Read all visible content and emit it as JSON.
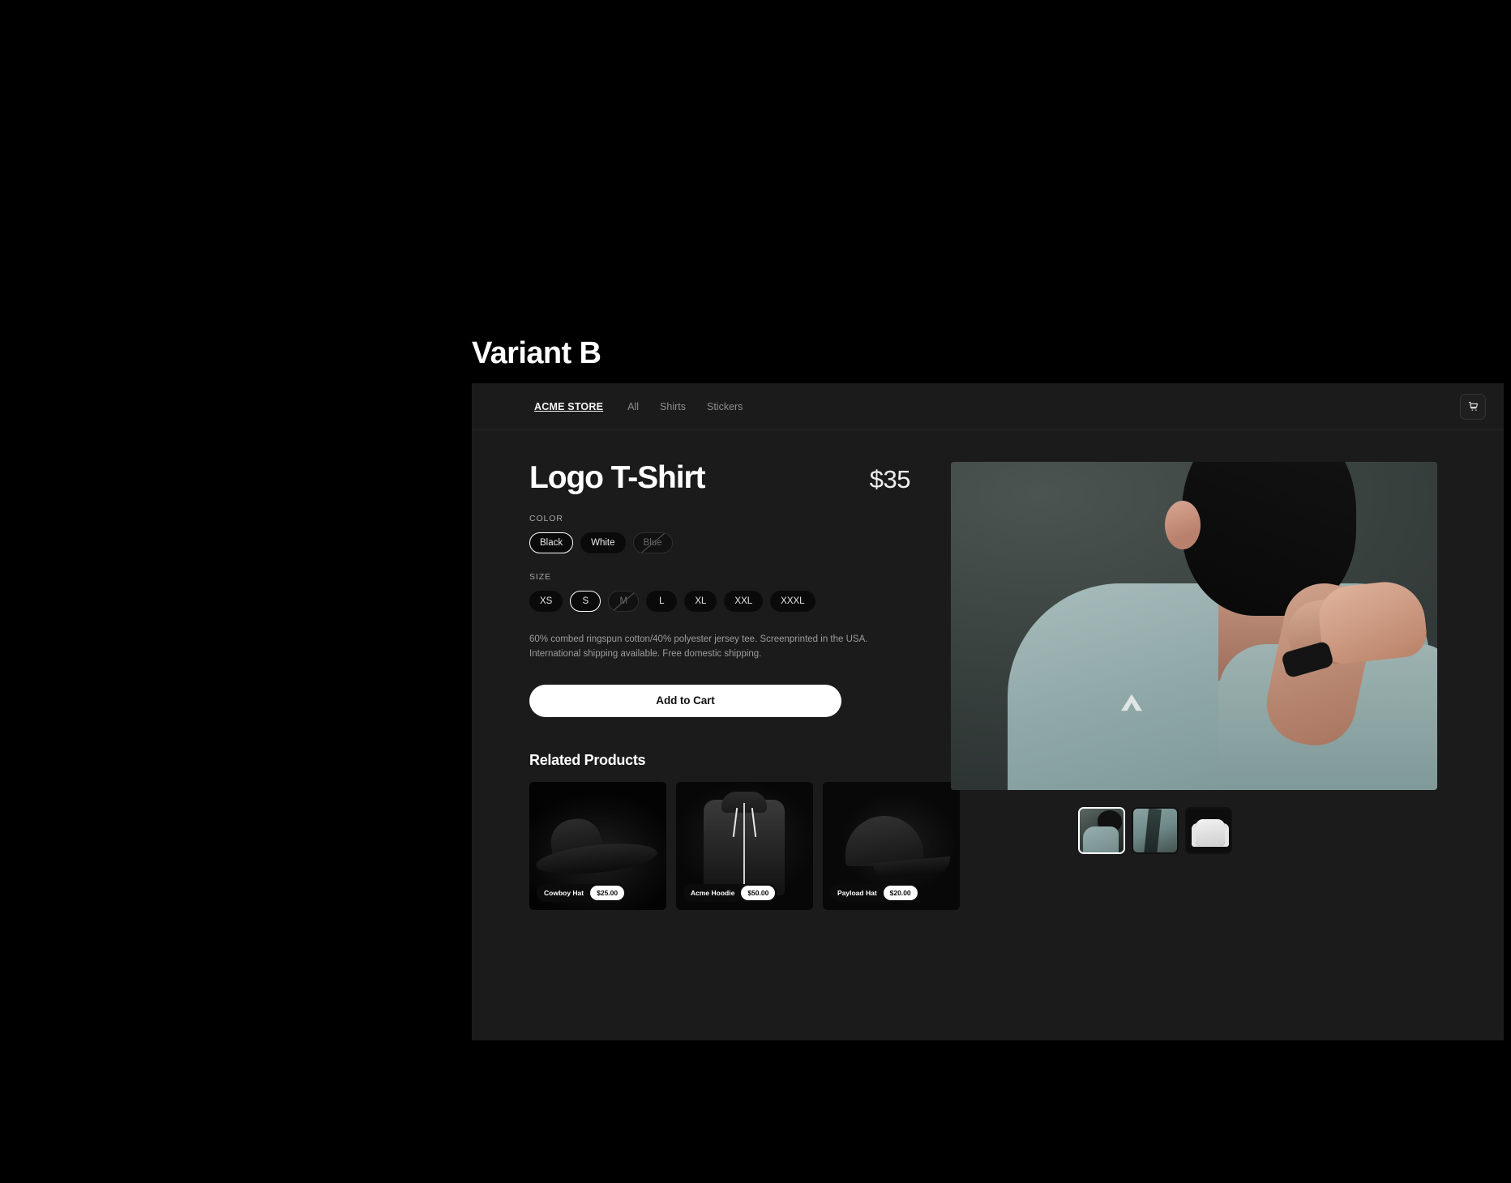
{
  "variant": {
    "label": "Variant B"
  },
  "store_header": {
    "brand": "ACME STORE",
    "nav": [
      {
        "label": "All"
      },
      {
        "label": "Shirts"
      },
      {
        "label": "Stickers"
      }
    ],
    "cart_icon": "shopping-cart-icon"
  },
  "product": {
    "title": "Logo T-Shirt",
    "price": "$35",
    "color_label": "COLOR",
    "colors": [
      {
        "label": "Black",
        "state": "selected"
      },
      {
        "label": "White",
        "state": "available"
      },
      {
        "label": "Blue",
        "state": "disabled"
      }
    ],
    "size_label": "SIZE",
    "sizes": [
      {
        "label": "XS",
        "state": "available"
      },
      {
        "label": "S",
        "state": "selected"
      },
      {
        "label": "M",
        "state": "disabled"
      },
      {
        "label": "L",
        "state": "available"
      },
      {
        "label": "XL",
        "state": "available"
      },
      {
        "label": "XXL",
        "state": "available"
      },
      {
        "label": "XXXL",
        "state": "available"
      }
    ],
    "description": "60% combed ringspun cotton/40% polyester jersey tee. Screenprinted in the USA. International shipping available. Free domestic shipping.",
    "add_to_cart_label": "Add to Cart"
  },
  "gallery": {
    "main_image_alt": "person-wearing-sage-green-logo-tee",
    "thumbnails": [
      {
        "alt": "model-shoulder-view",
        "state": "selected"
      },
      {
        "alt": "fabric-closeup",
        "state": "unselected"
      },
      {
        "alt": "white-tee-flat-lay",
        "state": "unselected"
      }
    ]
  },
  "related": {
    "heading": "Related Products",
    "items": [
      {
        "name": "Cowboy Hat",
        "price": "$25.00",
        "art": "art-hat"
      },
      {
        "name": "Acme Hoodie",
        "price": "$50.00",
        "art": "art-hoodie"
      },
      {
        "name": "Payload Hat",
        "price": "$20.00",
        "art": "art-cap"
      }
    ]
  },
  "colors": {
    "page_background": "#000000",
    "panel_background": "#1b1b1b",
    "accent_white": "#ffffff",
    "muted_text": "#9c9c9c"
  }
}
